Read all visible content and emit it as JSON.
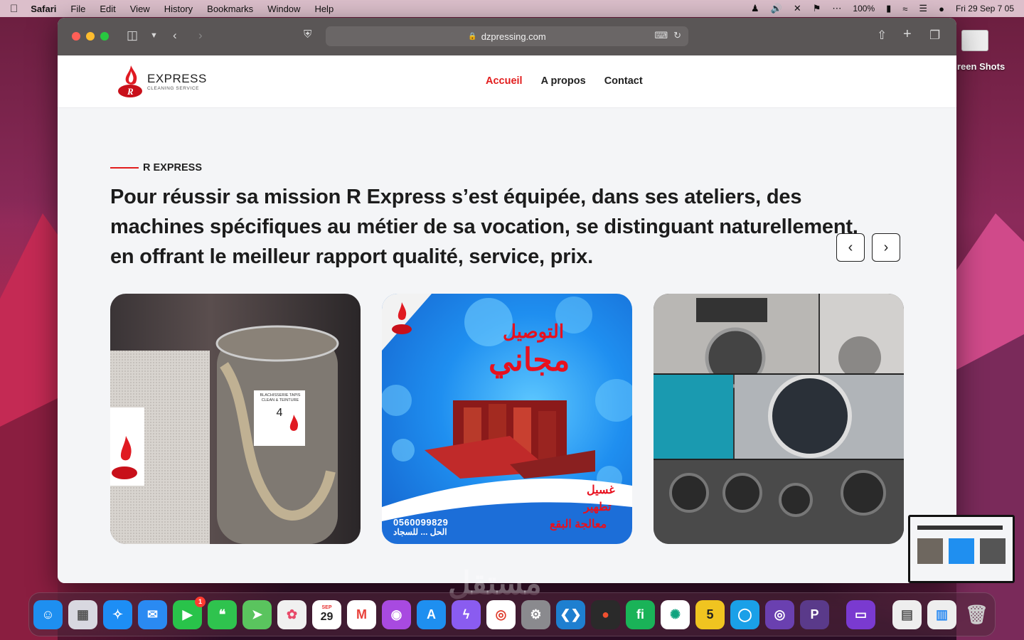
{
  "menubar": {
    "app": "Safari",
    "items": [
      "File",
      "Edit",
      "View",
      "History",
      "Bookmarks",
      "Window",
      "Help"
    ],
    "battery": "100%",
    "clock": "Fri 29 Sep  7 05"
  },
  "browser": {
    "url": "dzpressing.com"
  },
  "site": {
    "logo_brand": "EXPRESS",
    "logo_tagline": "CLEANING SERVICE",
    "nav": [
      {
        "label": "Accueil",
        "active": true
      },
      {
        "label": "A propos",
        "active": false
      },
      {
        "label": "Contact",
        "active": false
      }
    ],
    "eyebrow": "R EXPRESS",
    "headline": "Pour réussir sa mission R Express s’est équipée, dans ses ateliers, des machines spécifiques au métier de sa vocation, se distinguant naturellement, en offrant le meilleur rapport qualité, service, prix.",
    "promo": {
      "title1": "التوصيل",
      "title2": "مجاني",
      "services": [
        "غسيل",
        "تطهير",
        "معالجة البقع"
      ],
      "phone": "0560099829",
      "slogan": "الحل ... للسجاد"
    },
    "card1_label": "BLACHISSERIE TAPIS CLEAN & TEINTURE"
  },
  "desktop": {
    "side_label": "reen Shots",
    "calendar_month": "SEP",
    "calendar_day": "29",
    "facetime_badge": "1",
    "watermark": "مستقل"
  }
}
